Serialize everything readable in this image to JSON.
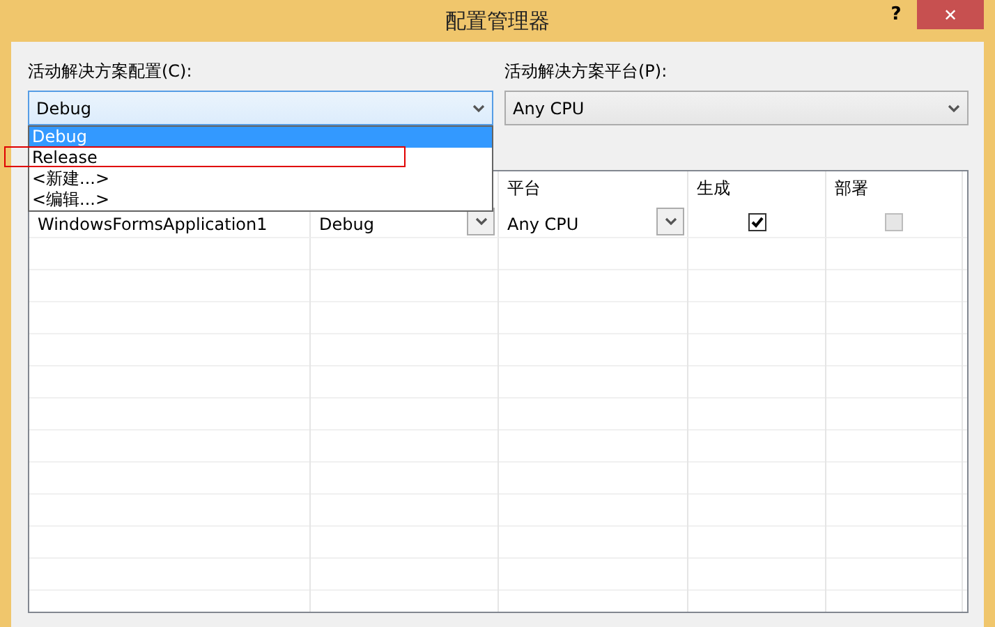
{
  "window": {
    "title": "配置管理器",
    "help": "?",
    "close": "✕"
  },
  "config": {
    "label": "活动解决方案配置(C):",
    "value": "Debug",
    "expanded": true,
    "options": [
      {
        "label": "Debug",
        "selected": true,
        "marked": false
      },
      {
        "label": "Release",
        "selected": false,
        "marked": true
      },
      {
        "label": "<新建...>",
        "selected": false,
        "marked": false
      },
      {
        "label": "<编辑...>",
        "selected": false,
        "marked": false
      }
    ]
  },
  "platform": {
    "label": "活动解决方案平台(P):",
    "value": "Any CPU"
  },
  "grid": {
    "columns": [
      "平台",
      "生成",
      "部署"
    ],
    "rows": [
      {
        "project": "WindowsFormsApplication1",
        "configuration": "Debug",
        "platform": "Any CPU",
        "build": {
          "checked": true,
          "disabled": false
        },
        "deploy": {
          "checked": false,
          "disabled": true
        }
      }
    ]
  }
}
